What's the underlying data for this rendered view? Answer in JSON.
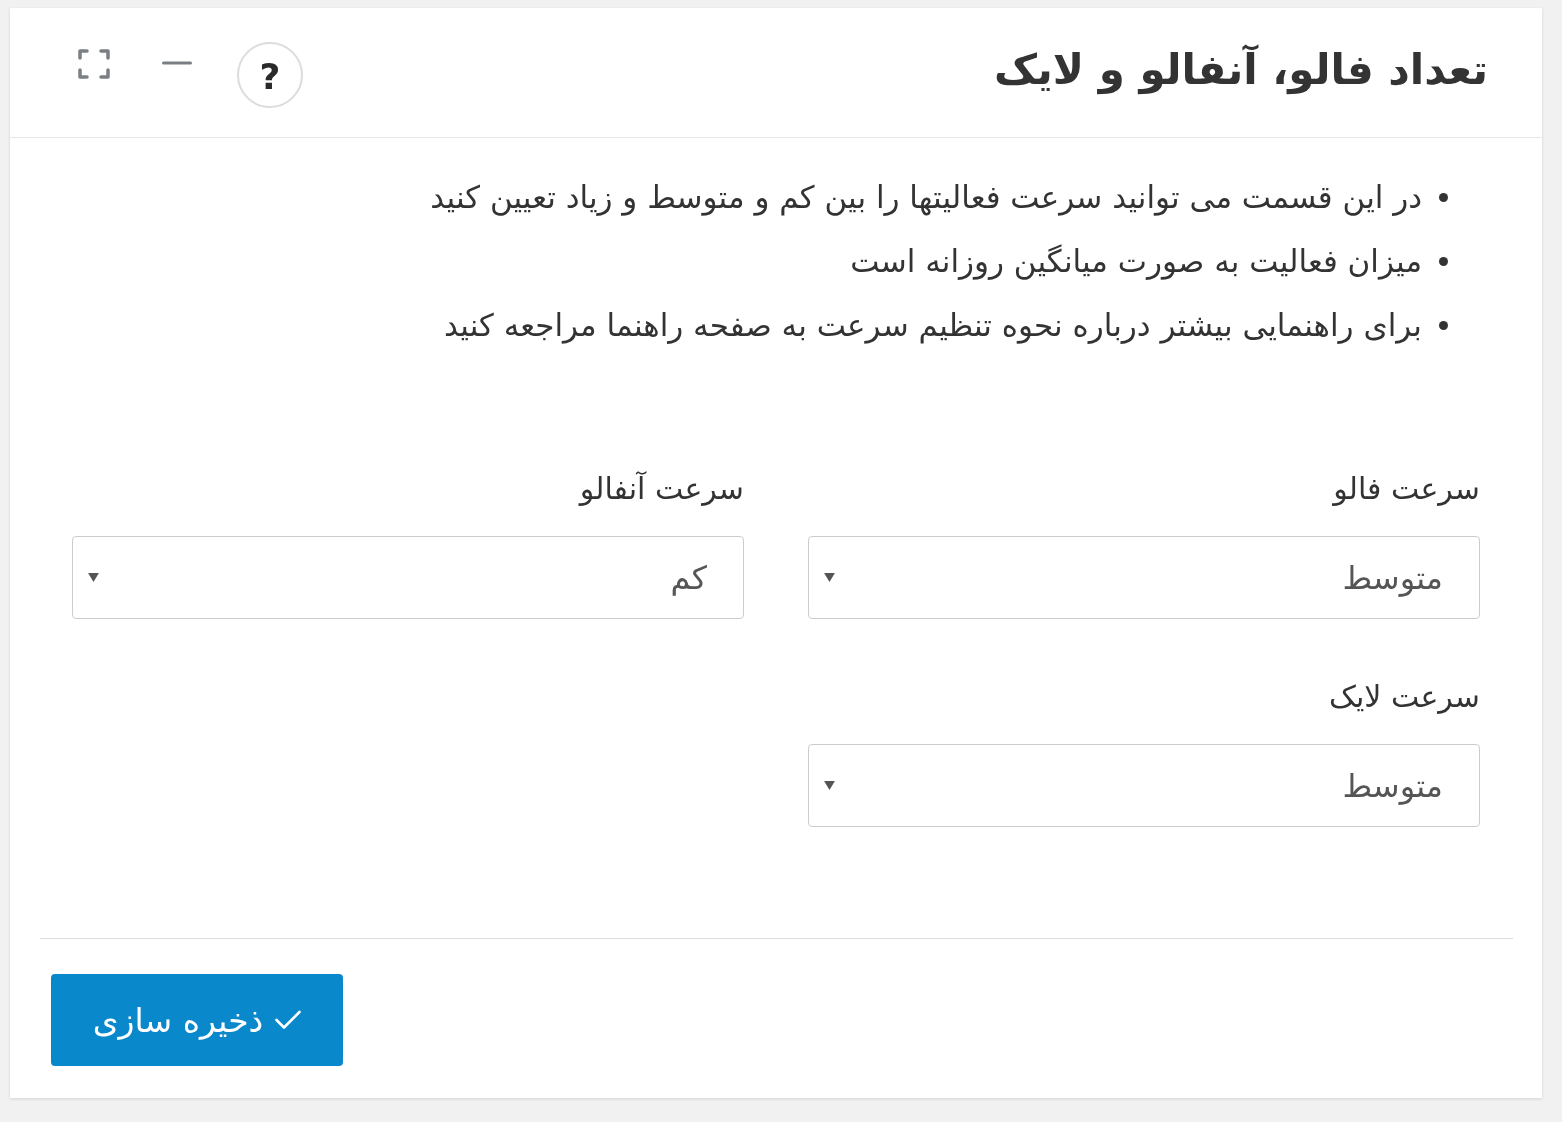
{
  "panel": {
    "title": "تعداد فالو، آنفالو و لایک",
    "help_button": {
      "label": "?"
    }
  },
  "notes": [
    "در این قسمت می توانید سرعت فعالیتها را بین کم و متوسط و زیاد تعیین کنید",
    "میزان فعالیت به صورت میانگین روزانه است",
    "برای راهنمایی بیشتر درباره نحوه تنظیم سرعت به صفحه راهنما مراجعه کنید"
  ],
  "fields": [
    {
      "label": "سرعت فالو",
      "value": "متوسط"
    },
    {
      "label": "سرعت آنفالو",
      "value": "کم"
    },
    {
      "label": "سرعت لایک",
      "value": "متوسط"
    }
  ],
  "save_button": {
    "label": "ذخیره سازی"
  }
}
